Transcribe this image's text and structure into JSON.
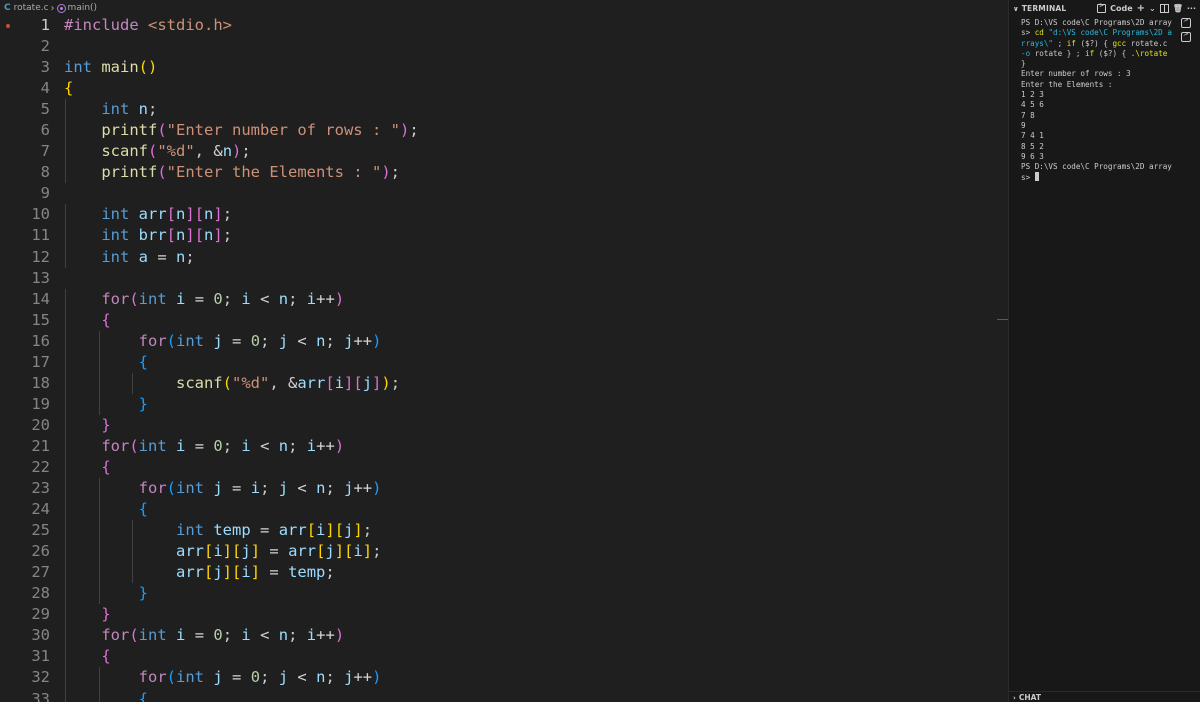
{
  "breadcrumb": {
    "lang_icon": "C",
    "file": "rotate.c",
    "symbol": "main()"
  },
  "code_lines": [
    {
      "n": "1",
      "html": "<span class=\"pre\">#include</span> <span class=\"inc\">&lt;stdio.h&gt;</span>"
    },
    {
      "n": "2",
      "html": ""
    },
    {
      "n": "3",
      "html": "<span class=\"kw\">int</span> <span class=\"fn\">main</span><span class=\"b1\">()</span>"
    },
    {
      "n": "4",
      "html": "<span class=\"b1\">{</span>"
    },
    {
      "n": "5",
      "html": "    <span class=\"kw\">int</span> <span class=\"var\">n</span>;"
    },
    {
      "n": "6",
      "html": "    <span class=\"fn\">printf</span><span class=\"b2\">(</span><span class=\"str\">\"Enter number of rows : \"</span><span class=\"b2\">)</span>;"
    },
    {
      "n": "7",
      "html": "    <span class=\"fn\">scanf</span><span class=\"b2\">(</span><span class=\"str\">\"%d\"</span>, <span class=\"op\">&amp;</span><span class=\"var\">n</span><span class=\"b2\">)</span>;"
    },
    {
      "n": "8",
      "html": "    <span class=\"fn\">printf</span><span class=\"b2\">(</span><span class=\"str\">\"Enter the Elements : \"</span><span class=\"b2\">)</span>;"
    },
    {
      "n": "9",
      "html": ""
    },
    {
      "n": "10",
      "html": "    <span class=\"kw\">int</span> <span class=\"var\">arr</span><span class=\"b2\">[</span><span class=\"var\">n</span><span class=\"b2\">][</span><span class=\"var\">n</span><span class=\"b2\">]</span>;"
    },
    {
      "n": "11",
      "html": "    <span class=\"kw\">int</span> <span class=\"var\">brr</span><span class=\"b2\">[</span><span class=\"var\">n</span><span class=\"b2\">][</span><span class=\"var\">n</span><span class=\"b2\">]</span>;"
    },
    {
      "n": "12",
      "html": "    <span class=\"kw\">int</span> <span class=\"var\">a</span> <span class=\"op\">=</span> <span class=\"var\">n</span>;"
    },
    {
      "n": "13",
      "html": ""
    },
    {
      "n": "14",
      "html": "    <span class=\"ctl\">for</span><span class=\"b2\">(</span><span class=\"kw\">int</span> <span class=\"var\">i</span> <span class=\"op\">=</span> <span class=\"num\">0</span>; <span class=\"var\">i</span> <span class=\"op\">&lt;</span> <span class=\"var\">n</span>; <span class=\"var\">i</span><span class=\"op\">++</span><span class=\"b2\">)</span>"
    },
    {
      "n": "15",
      "html": "    <span class=\"b2\">{</span>"
    },
    {
      "n": "16",
      "html": "        <span class=\"ctl\">for</span><span class=\"b3\">(</span><span class=\"kw\">int</span> <span class=\"var\">j</span> <span class=\"op\">=</span> <span class=\"num\">0</span>; <span class=\"var\">j</span> <span class=\"op\">&lt;</span> <span class=\"var\">n</span>; <span class=\"var\">j</span><span class=\"op\">++</span><span class=\"b3\">)</span>"
    },
    {
      "n": "17",
      "html": "        <span class=\"b3\">{</span>"
    },
    {
      "n": "18",
      "html": "            <span class=\"fn\">scanf</span><span class=\"b1\">(</span><span class=\"str\">\"%d\"</span>, <span class=\"op\">&amp;</span><span class=\"var\">arr</span><span class=\"b2\">[</span><span class=\"var\">i</span><span class=\"b2\">][</span><span class=\"var\">j</span><span class=\"b2\">]</span><span class=\"b1\">)</span>;"
    },
    {
      "n": "19",
      "html": "        <span class=\"b3\">}</span>"
    },
    {
      "n": "20",
      "html": "    <span class=\"b2\">}</span>"
    },
    {
      "n": "21",
      "html": "    <span class=\"ctl\">for</span><span class=\"b2\">(</span><span class=\"kw\">int</span> <span class=\"var\">i</span> <span class=\"op\">=</span> <span class=\"num\">0</span>; <span class=\"var\">i</span> <span class=\"op\">&lt;</span> <span class=\"var\">n</span>; <span class=\"var\">i</span><span class=\"op\">++</span><span class=\"b2\">)</span>"
    },
    {
      "n": "22",
      "html": "    <span class=\"b2\">{</span>"
    },
    {
      "n": "23",
      "html": "        <span class=\"ctl\">for</span><span class=\"b3\">(</span><span class=\"kw\">int</span> <span class=\"var\">j</span> <span class=\"op\">=</span> <span class=\"var\">i</span>; <span class=\"var\">j</span> <span class=\"op\">&lt;</span> <span class=\"var\">n</span>; <span class=\"var\">j</span><span class=\"op\">++</span><span class=\"b3\">)</span>"
    },
    {
      "n": "24",
      "html": "        <span class=\"b3\">{</span>"
    },
    {
      "n": "25",
      "html": "            <span class=\"kw\">int</span> <span class=\"var\">temp</span> <span class=\"op\">=</span> <span class=\"var\">arr</span><span class=\"b1\">[</span><span class=\"var\">i</span><span class=\"b1\">][</span><span class=\"var\">j</span><span class=\"b1\">]</span>;"
    },
    {
      "n": "26",
      "html": "            <span class=\"var\">arr</span><span class=\"b1\">[</span><span class=\"var\">i</span><span class=\"b1\">][</span><span class=\"var\">j</span><span class=\"b1\">]</span> <span class=\"op\">=</span> <span class=\"var\">arr</span><span class=\"b1\">[</span><span class=\"var\">j</span><span class=\"b1\">][</span><span class=\"var\">i</span><span class=\"b1\">]</span>;"
    },
    {
      "n": "27",
      "html": "            <span class=\"var\">arr</span><span class=\"b1\">[</span><span class=\"var\">j</span><span class=\"b1\">][</span><span class=\"var\">i</span><span class=\"b1\">]</span> <span class=\"op\">=</span> <span class=\"var\">temp</span>;"
    },
    {
      "n": "28",
      "html": "        <span class=\"b3\">}</span>"
    },
    {
      "n": "29",
      "html": "    <span class=\"b2\">}</span>"
    },
    {
      "n": "30",
      "html": "    <span class=\"ctl\">for</span><span class=\"b2\">(</span><span class=\"kw\">int</span> <span class=\"var\">i</span> <span class=\"op\">=</span> <span class=\"num\">0</span>; <span class=\"var\">i</span> <span class=\"op\">&lt;</span> <span class=\"var\">n</span>; <span class=\"var\">i</span><span class=\"op\">++</span><span class=\"b2\">)</span>"
    },
    {
      "n": "31",
      "html": "    <span class=\"b2\">{</span>"
    },
    {
      "n": "32",
      "html": "        <span class=\"ctl\">for</span><span class=\"b3\">(</span><span class=\"kw\">int</span> <span class=\"var\">j</span> <span class=\"op\">=</span> <span class=\"num\">0</span>; <span class=\"var\">j</span> <span class=\"op\">&lt;</span> <span class=\"var\">n</span>; <span class=\"var\">j</span><span class=\"op\">++</span><span class=\"b3\">)</span>"
    },
    {
      "n": "33",
      "html": "        <span class=\"b3\">{</span>"
    }
  ],
  "panel": {
    "title": "TERMINAL",
    "shell_label": "Code",
    "add_icon": "+",
    "dropdown_icon": "⌄",
    "more_icon": "···",
    "chat_title": "CHAT"
  },
  "terminal_lines": [
    "PS D:\\VS code\\C Programs\\2D array",
    "s> <span class=\"t-yel\">cd</span> <span class=\"t-cyan\">\"d:\\VS code\\C Programs\\2D a</span>",
    "<span class=\"t-cyan\">rrays\\\"</span> ; <span class=\"t-yel\">if</span> ($?) { <span class=\"t-yel\">gcc</span> rotate.c",
    "<span class=\"t-cyan\">-o</span> rotate } ; <span class=\"t-yel\">if</span> ($?) { <span class=\"t-yel\">.\\rotate</span>",
    "}",
    "Enter number of rows : 3",
    "Enter the Elements :",
    "1 2 3",
    "4 5 6",
    "7 8",
    "9",
    "7 4 1",
    "8 5 2",
    "9 6 3",
    "PS D:\\VS code\\C Programs\\2D array",
    "s> <span class=\"t-cursor\"></span>"
  ]
}
